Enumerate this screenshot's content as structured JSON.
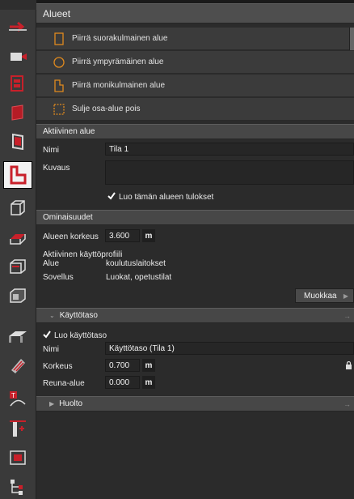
{
  "areas": {
    "title": "Alueet",
    "commands": [
      "Piirrä suorakulmainen alue",
      "Piirrä ympyrämäinen alue",
      "Piirrä monikulmainen alue",
      "Sulje osa-alue pois"
    ]
  },
  "active_area": {
    "title": "Aktiivinen alue",
    "name_label": "Nimi",
    "name_value": "Tila 1",
    "description_label": "Kuvaus",
    "description_value": "",
    "results_checkbox_label": "Luo tämän alueen tulokset",
    "results_checked": true
  },
  "properties": {
    "title": "Ominaisuudet",
    "height_label": "Alueen korkeus",
    "height_value": "3.600",
    "height_unit": "m",
    "profile_title": "Aktiivinen käyttöprofiili",
    "area_label": "Alue",
    "area_value": "koulutuslaitokset",
    "application_label": "Sovellus",
    "application_value": "Luokat, opetustilat",
    "edit_button": "Muokkaa"
  },
  "usage_level": {
    "title": "Käyttötaso",
    "create_checkbox_label": "Luo käyttötaso",
    "create_checked": true,
    "name_label": "Nimi",
    "name_value": "Käyttötaso (Tila 1)",
    "height_label": "Korkeus",
    "height_value": "0.700",
    "height_unit": "m",
    "edge_label": "Reuna-alue",
    "edge_value": "0.000",
    "edge_unit": "m"
  },
  "maintenance": {
    "title": "Huolto"
  },
  "toolbar_icons": [
    "arrow-move-icon",
    "camera-icon",
    "building-red-icon",
    "wall-red-icon",
    "door-red-icon",
    "area-l-shape-icon",
    "cube-wireframe-icon",
    "floor-plane-icon",
    "box-section-icon",
    "box-solid-icon",
    "roof-icon",
    "hatch-tool-icon",
    "text-curve-icon",
    "column-insert-icon",
    "frame-red-icon",
    "tree-layout-icon"
  ],
  "colors": {
    "panel_bg": "#2b2b2b",
    "header_bg": "#4e4e4e",
    "accent_orange": "#e08a1e",
    "icon_red": "#c8202a"
  }
}
